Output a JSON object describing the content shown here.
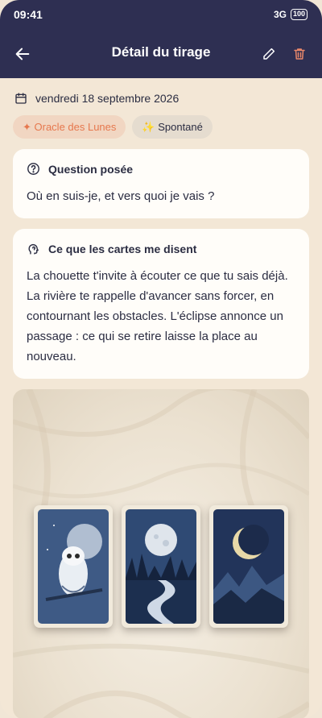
{
  "status": {
    "time": "09:41",
    "network": "3G",
    "battery": "100"
  },
  "header": {
    "title": "Détail du tirage",
    "back_icon": "arrow-left-icon",
    "edit_icon": "pencil-icon",
    "delete_icon": "trash-icon"
  },
  "meta": {
    "date": "vendredi 18 septembre 2026"
  },
  "tags": {
    "oracle": "✦ Oracle des Lunes",
    "mode": "✨ Spontané"
  },
  "question": {
    "heading": "Question posée",
    "text": "Où en suis-je, et vers quoi je vais ?"
  },
  "interpretation": {
    "heading": "Ce que les cartes me disent",
    "text": "La chouette t'invite à écouter ce que tu sais déjà. La rivière te rappelle d'avancer sans forcer, en contournant les obstacles. L'éclipse annonce un passage : ce qui se retire laisse la place au nouveau."
  },
  "photo": {
    "cards": [
      "owl",
      "river",
      "eclipse"
    ]
  },
  "colors": {
    "header_bg": "#2e2f52",
    "page_bg": "#f3e7d6",
    "accent": "#e6784e",
    "trash": "#e8876a"
  }
}
